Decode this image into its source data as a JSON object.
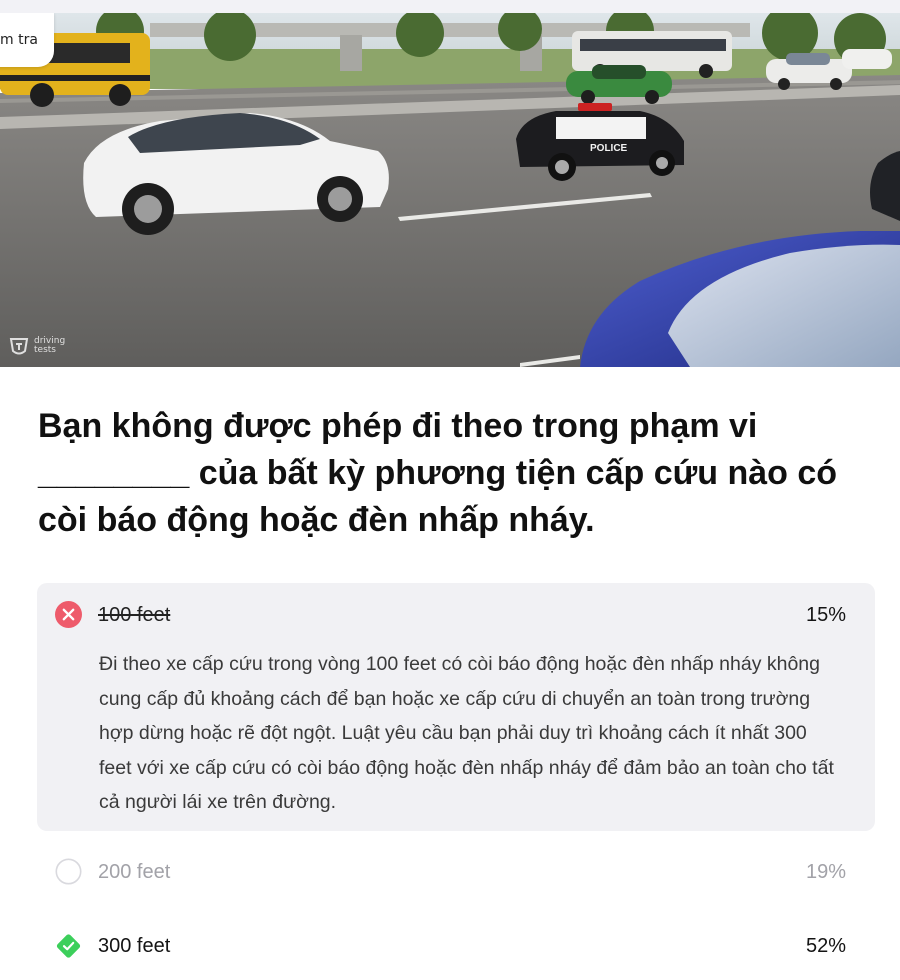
{
  "hero": {
    "tag_label": "m tra",
    "watermark_text": "driving tests",
    "police_text": "POLICE",
    "colors": {
      "road": "#6e6d6b",
      "grass": "#8da56a",
      "tree": "#4a6b32",
      "white_car": "#f2f2f2",
      "police_car": "#1c1c1f",
      "blue_car": "#2f3fa8",
      "school_bus": "#e3b21c"
    }
  },
  "question": "Bạn không được phép đi theo trong phạm vi ________ của bất kỳ phương tiện cấp cứu nào có còi báo động hoặc đèn nhấp nháy.",
  "answers": [
    {
      "label": "100 feet",
      "percent": "15%",
      "state": "wrong-selected",
      "explanation": "Đi theo xe cấp cứu trong vòng 100 feet có còi báo động hoặc đèn nhấp nháy không cung cấp đủ khoảng cách để bạn hoặc xe cấp cứu di chuyển an toàn trong trường hợp dừng hoặc rẽ đột ngột. Luật yêu cầu bạn phải duy trì khoảng cách ít nhất 300 feet với xe cấp cứu có còi báo động hoặc đèn nhấp nháy để đảm bảo an toàn cho tất cả người lái xe trên đường."
    },
    {
      "label": "200 feet",
      "percent": "19%",
      "state": "unselected"
    },
    {
      "label": "300 feet",
      "percent": "52%",
      "state": "correct"
    }
  ],
  "colors": {
    "wrong": "#ee5b6b",
    "correct": "#3ccf5b",
    "muted_text": "#a2a2a8",
    "answer_bg": "#f1f1f4"
  }
}
